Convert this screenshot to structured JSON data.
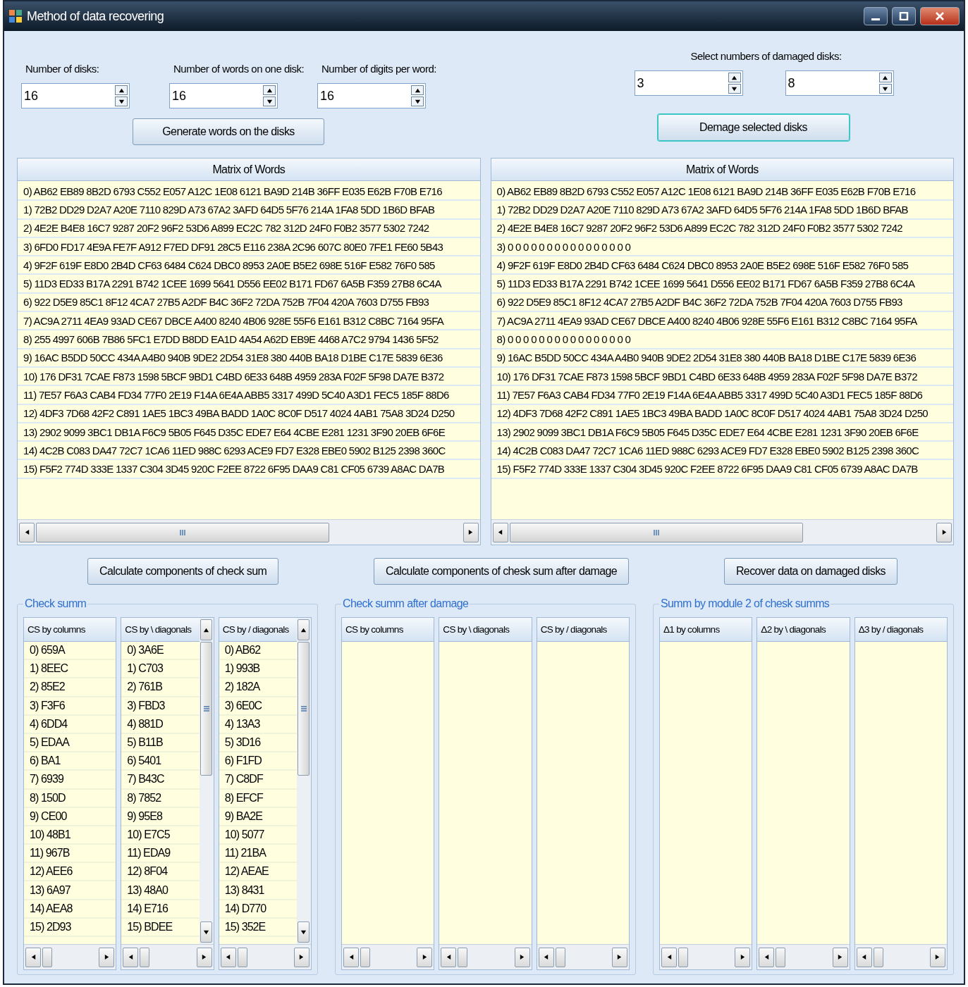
{
  "window": {
    "title": "Method of data recovering"
  },
  "inputs": [
    {
      "label": "Number of disks:",
      "value": "16"
    },
    {
      "label": "Number of words on one disk:",
      "value": "16"
    },
    {
      "label": "Number of digits per word:",
      "value": "16"
    }
  ],
  "generate_button": "Generate words on the disks",
  "damaged": {
    "label": "Select numbers of damaged disks:",
    "values": [
      "3",
      "8"
    ]
  },
  "damage_button": "Demage selected disks",
  "matrices": [
    {
      "title": "Matrix of Words",
      "rows": [
        "0) AB62 EB89 8B2D 6793 C552 E057 A12C 1E08 6121 BA9D 214B 36FF E035 E62B F70B E716",
        "1) 72B2 DD29 D2A7 A20E 7110 829D A73 67A2 3AFD 64D5 5F76 214A 1FA8 5DD 1B6D BFAB",
        "2) 4E2E B4E8 16C7 9287 20F2 96F2 53D6 A899 EC2C 782 312D 24F0 F0B2 3577 5302 7242",
        "3) 6FD0 FD17 4E9A FE7F A912 F7ED DF91 28C5 E116 238A 2C96 607C 80E0 7FE1 FE60 5B43",
        "4) 9F2F 619F E8D0 2B4D CF63 6484 C624 DBC0 8953 2A0E B5E2 698E 516F E582 76F0 585",
        "5) 11D3 ED33 B17A 2291 B742 1CEE 1699 5641 D556 EE02 B171 FD67 6A5B F359 27B8 6C4A",
        "6) 922 D5E9 85C1 8F12 4CA7 27B5 A2DF B4C 36F2 72DA 752B 7F04 420A 7603 D755 FB93",
        "7) AC9A 2711 4EA9 93AD CE67 DBCE A400 8240 4B06 928E 55F6 E161 B312 C8BC 7164 95FA",
        "8) 255 4997 606B 7B86 5FC1 E7DD B8DD EA1D 4A54 A62D EB9E 4468 A7C2 9794 1436 5F52",
        "9) 16AC B5DD 50CC 434A A4B0 940B 9DE2 2D54 31E8 380 440B BA18 D1BE C17E 5839 6E36",
        "10) 176 DF31 7CAE F873 1598 5BCF 9BD1 C4BD 6E33 648B 4959 283A F02F 5F98 DA7E B372",
        "11) 7E57 F6A3 CAB4 FD34 77F0 2E19 F14A 6E4A ABB5 3317 499D 5C40 A3D1 FEC5 185F 88D6",
        "12) 4DF3 7D68 42F2 C891 1AE5 1BC3 49BA BADD 1A0C 8C0F D517 4024 4AB1 75A8 3D24 D250",
        "13) 2902 9099 3BC1 DB1A F6C9 5B05 F645 D35C EDE7 E64 4CBE E281 1231 3F90 20EB 6F6E",
        "14) 4C2B C083 DA47 72C7 1CA6 11ED 988C 6293 ACE9 FD7 E328 EBE0 5902 B125 2398 360C",
        "15) F5F2 774D 333E 1337 C304 3D45 920C F2EE 8722 6F95 DAA9 C81 CF05 6739 A8AC DA7B"
      ]
    },
    {
      "title": "Matrix of Words",
      "rows": [
        "0) AB62 EB89 8B2D 6793 C552 E057 A12C 1E08 6121 BA9D 214B 36FF E035 E62B F70B E716",
        "1) 72B2 DD29 D2A7 A20E 7110 829D A73 67A2 3AFD 64D5 5F76 214A 1FA8 5DD 1B6D BFAB",
        "2) 4E2E B4E8 16C7 9287 20F2 96F2 53D6 A899 EC2C 782 312D 24F0 F0B2 3577 5302 7242",
        "3) 0 0 0 0 0 0 0 0 0 0 0 0 0 0 0 0",
        "4) 9F2F 619F E8D0 2B4D CF63 6484 C624 DBC0 8953 2A0E B5E2 698E 516F E582 76F0 585",
        "5) 11D3 ED33 B17A 2291 B742 1CEE 1699 5641 D556 EE02 B171 FD67 6A5B F359 27B8 6C4A",
        "6) 922 D5E9 85C1 8F12 4CA7 27B5 A2DF B4C 36F2 72DA 752B 7F04 420A 7603 D755 FB93",
        "7) AC9A 2711 4EA9 93AD CE67 DBCE A400 8240 4B06 928E 55F6 E161 B312 C8BC 7164 95FA",
        "8) 0 0 0 0 0 0 0 0 0 0 0 0 0 0 0 0",
        "9) 16AC B5DD 50CC 434A A4B0 940B 9DE2 2D54 31E8 380 440B BA18 D1BE C17E 5839 6E36",
        "10) 176 DF31 7CAE F873 1598 5BCF 9BD1 C4BD 6E33 648B 4959 283A F02F 5F98 DA7E B372",
        "11) 7E57 F6A3 CAB4 FD34 77F0 2E19 F14A 6E4A ABB5 3317 499D 5C40 A3D1 FEC5 185F 88D6",
        "12) 4DF3 7D68 42F2 C891 1AE5 1BC3 49BA BADD 1A0C 8C0F D517 4024 4AB1 75A8 3D24 D250",
        "13) 2902 9099 3BC1 DB1A F6C9 5B05 F645 D35C EDE7 E64 4CBE E281 1231 3F90 20EB 6F6E",
        "14) 4C2B C083 DA47 72C7 1CA6 11ED 988C 6293 ACE9 FD7 E328 EBE0 5902 B125 2398 360C",
        "15) F5F2 774D 333E 1337 C304 3D45 920C F2EE 8722 6F95 DAA9 C81 CF05 6739 A8AC DA7B"
      ]
    }
  ],
  "action_buttons": [
    "Calculate components of check sum",
    "Calculate components of chesk sum after damage",
    "Recover data on damaged disks"
  ],
  "groups": [
    {
      "title": "Check summ",
      "lists": [
        {
          "header": "CS by columns",
          "vscroll": false,
          "items": [
            "0) 659A",
            "1) 8EEC",
            "2) 85E2",
            "3) F3F6",
            "4) 6DD4",
            "5) EDAA",
            "6) BA1",
            "7) 6939",
            "8) 150D",
            "9) CE00",
            "10) 48B1",
            "11) 967B",
            "12) AEE6",
            "13) 6A97",
            "14) AEA8",
            "15) 2D93"
          ]
        },
        {
          "header": "CS by \\ diagonals",
          "vscroll": true,
          "items": [
            "0) 3A6E",
            "1) C703",
            "2) 761B",
            "3) FBD3",
            "4) 881D",
            "5) B11B",
            "6) 5401",
            "7) B43C",
            "8) 7852",
            "9) 95E8",
            "10) E7C5",
            "11) EDA9",
            "12) 8F04",
            "13) 48A0",
            "14) E716",
            "15) BDEE"
          ]
        },
        {
          "header": "CS by / diagonals",
          "vscroll": true,
          "items": [
            "0) AB62",
            "1) 993B",
            "2) 182A",
            "3) 6E0C",
            "4) 13A3",
            "5) 3D16",
            "6) F1FD",
            "7) C8DF",
            "8) EFCF",
            "9) BA2E",
            "10) 5077",
            "11) 21BA",
            "12) AEAE",
            "13) 8431",
            "14) D770",
            "15) 352E"
          ]
        }
      ]
    },
    {
      "title": "Check summ after damage",
      "lists": [
        {
          "header": "CS by columns",
          "vscroll": false
        },
        {
          "header": "CS by \\ diagonals",
          "vscroll": false
        },
        {
          "header": "CS by / diagonals",
          "vscroll": false
        }
      ]
    },
    {
      "title": "Summ by module 2 of chesk summs",
      "lists": [
        {
          "header": "Δ1 by columns",
          "vscroll": false
        },
        {
          "header": "Δ2 by \\ diagonals",
          "vscroll": false
        },
        {
          "header": "Δ3 by / diagonals",
          "vscroll": false
        }
      ]
    }
  ]
}
